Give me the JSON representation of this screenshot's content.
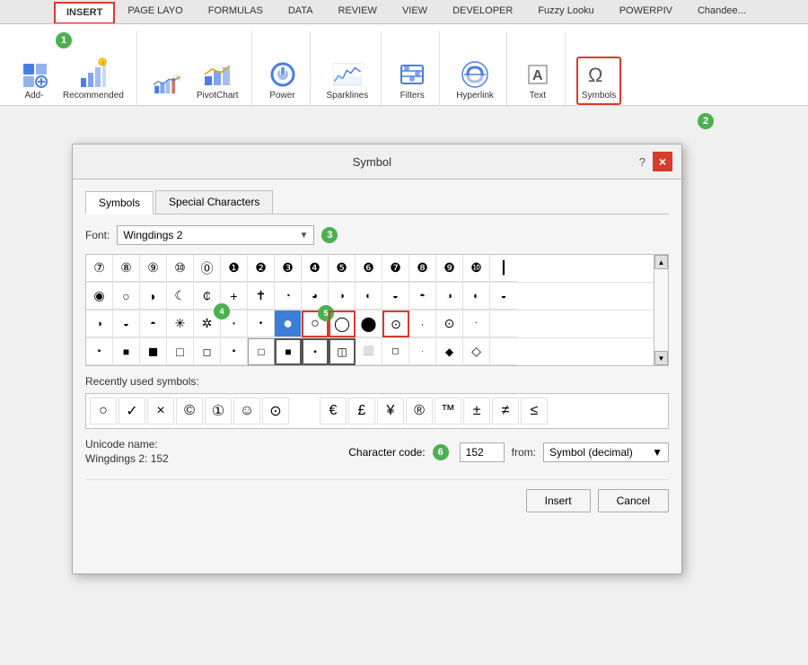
{
  "ribbon": {
    "tabs": [
      {
        "id": "insert",
        "label": "INSERT",
        "active": true
      },
      {
        "id": "page_layout",
        "label": "PAGE LAYO"
      },
      {
        "id": "formulas",
        "label": "FORMULAS"
      },
      {
        "id": "data",
        "label": "DATA"
      },
      {
        "id": "review",
        "label": "REVIEW"
      },
      {
        "id": "view",
        "label": "VIEW"
      },
      {
        "id": "developer",
        "label": "DEVELOPER"
      },
      {
        "id": "fuzzy",
        "label": "Fuzzy Looku"
      },
      {
        "id": "powerpiv",
        "label": "POWERPIV"
      },
      {
        "id": "chandee",
        "label": "Chandee..."
      }
    ],
    "groups": [
      {
        "id": "tables",
        "items": [
          {
            "id": "addin",
            "label": "Add-",
            "icon": "addin-icon"
          },
          {
            "id": "recommended",
            "label": "Recommended",
            "icon": "recommended-icon"
          }
        ]
      },
      {
        "id": "charts",
        "items": [
          {
            "id": "charts_group",
            "label": "",
            "icon": "charts-icon"
          },
          {
            "id": "pivotchart",
            "label": "PivotChart",
            "icon": "pivotchart-icon"
          }
        ]
      },
      {
        "id": "tours",
        "items": [
          {
            "id": "power",
            "label": "Power",
            "icon": "power-icon"
          }
        ]
      },
      {
        "id": "sparklines",
        "items": [
          {
            "id": "sparklines",
            "label": "Sparklines",
            "icon": "sparklines-icon"
          }
        ]
      },
      {
        "id": "filters",
        "items": [
          {
            "id": "filters",
            "label": "Filters",
            "icon": "filters-icon"
          }
        ]
      },
      {
        "id": "links",
        "items": [
          {
            "id": "hyperlink",
            "label": "Hyperlink",
            "icon": "hyperlink-icon"
          }
        ]
      },
      {
        "id": "text_group",
        "items": [
          {
            "id": "text",
            "label": "Text",
            "icon": "text-icon"
          }
        ]
      },
      {
        "id": "symbols_group",
        "items": [
          {
            "id": "symbols",
            "label": "Symbols",
            "icon": "symbols-icon",
            "highlighted": true
          }
        ]
      }
    ],
    "badge1_label": "1",
    "badge2_label": "2"
  },
  "dialog": {
    "title": "Symbol",
    "help_label": "?",
    "close_label": "×",
    "tabs": [
      {
        "id": "symbols",
        "label": "Symbols",
        "active": true
      },
      {
        "id": "special_chars",
        "label": "Special Characters",
        "active": false
      }
    ],
    "font_label": "Font:",
    "font_value": "Wingdings 2",
    "font_badge": "3",
    "scrollbar_up": "▲",
    "scrollbar_down": "▼",
    "recently_used_label": "Recently used symbols:",
    "recently_used": [
      "○",
      "✓",
      "×",
      "©",
      "①",
      "☺",
      "⊙",
      "€",
      "£",
      "¥",
      "®",
      "™",
      "±",
      "≠",
      "≤"
    ],
    "unicode_name_label": "Unicode name:",
    "unicode_value": "Wingdings 2: 152",
    "char_code_label": "Character code:",
    "char_code_value": "152",
    "from_label": "from:",
    "from_value": "Symbol (decimal)",
    "badge4_label": "4",
    "badge5_label": "5",
    "badge6_label": "6",
    "insert_btn": "Insert",
    "cancel_btn": "Cancel",
    "symbol_rows": [
      [
        "⑦",
        "⑧",
        "⑨",
        "⑩",
        "⓪",
        "①",
        "②",
        "③",
        "④",
        "⑤",
        "⑥",
        "⑦",
        "⑧",
        "⑨",
        "⑩",
        "║"
      ],
      [
        "◎",
        "○",
        "◗",
        "☽",
        "₵",
        "+",
        "✝",
        "◔",
        "◕",
        "◑",
        "◐",
        "◒",
        "◓",
        "◑",
        "◒",
        "◓"
      ],
      [
        "◑",
        "◑",
        "◑",
        "✳",
        "❊",
        "•",
        "•",
        "●",
        "○",
        "◯",
        "⬤",
        "⬛",
        "◉",
        "⊙",
        "⋅"
      ],
      [
        "▪",
        "■",
        "◼",
        "□",
        "◻",
        "▪",
        "□",
        "■",
        "▪",
        "◫",
        "⬜",
        "◻",
        "▪",
        "•",
        "◆",
        "◇"
      ]
    ]
  }
}
